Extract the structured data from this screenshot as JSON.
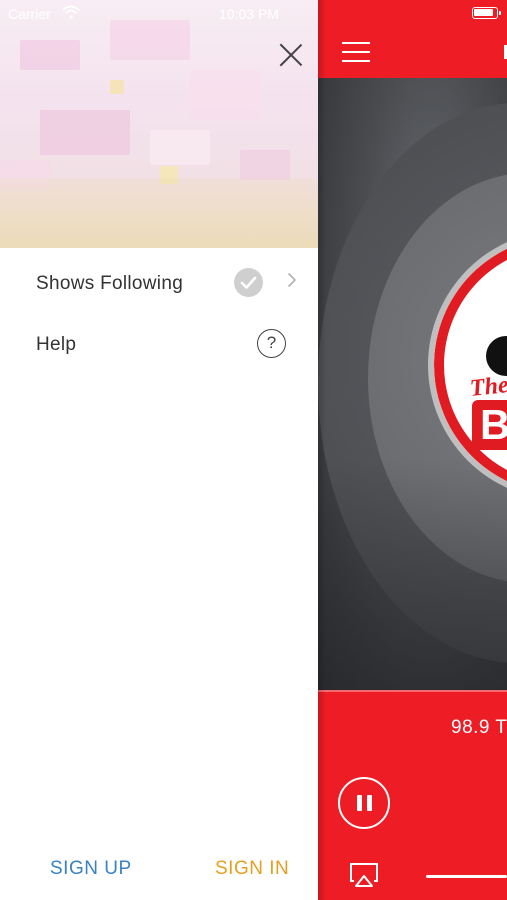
{
  "status_bar": {
    "carrier": "Carrier",
    "time": "10:03 PM"
  },
  "drawer": {
    "menu": [
      {
        "label": "Shows Following",
        "icon": "check-icon",
        "has_chevron": true
      },
      {
        "label": "Help",
        "icon": "help-icon",
        "icon_text": "?"
      }
    ],
    "footer": {
      "sign_up_label": "SIGN UP",
      "sign_in_label": "SIGN IN"
    }
  },
  "player": {
    "station_name": "98.9 T",
    "logo_text_the": "The",
    "logo_text_b": "B"
  },
  "colors": {
    "brand_red": "#ee1c25",
    "sign_up": "#3b82c4",
    "sign_in": "#e6a021",
    "menu_text": "#333333"
  }
}
